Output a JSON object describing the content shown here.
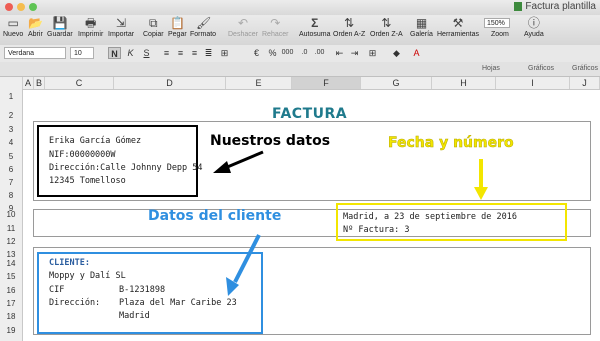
{
  "window": {
    "title": "Factura plantilla"
  },
  "toolbar": {
    "buttons": [
      {
        "label": "Nuevo",
        "icon": "new-file-icon"
      },
      {
        "label": "Abrir",
        "icon": "open-folder-icon"
      },
      {
        "label": "Guardar",
        "icon": "save-icon"
      },
      {
        "label": "Imprimir",
        "icon": "print-icon"
      },
      {
        "label": "Importar",
        "icon": "import-icon"
      },
      {
        "label": "Copiar",
        "icon": "copy-icon"
      },
      {
        "label": "Pegar",
        "icon": "paste-icon"
      },
      {
        "label": "Formato",
        "icon": "format-brush-icon"
      },
      {
        "label": "Deshacer",
        "icon": "undo-icon"
      },
      {
        "label": "Rehacer",
        "icon": "redo-icon"
      },
      {
        "label": "Autosuma",
        "icon": "autosum-icon"
      },
      {
        "label": "Orden A-Z",
        "icon": "sort-asc-icon"
      },
      {
        "label": "Orden Z-A",
        "icon": "sort-desc-icon"
      },
      {
        "label": "Galería",
        "icon": "gallery-icon"
      },
      {
        "label": "Herramientas",
        "icon": "tools-icon"
      },
      {
        "label": "Zoom",
        "icon": "zoom-icon"
      },
      {
        "label": "Ayuda",
        "icon": "help-icon"
      }
    ],
    "zoom_value": "150%"
  },
  "format": {
    "font": "Verdana",
    "size": "10"
  },
  "ribbon": {
    "tabs": [
      "Hojas",
      "Gráficos",
      "Gráficos"
    ]
  },
  "columns": [
    "A",
    "B",
    "C",
    "D",
    "E",
    "F",
    "G",
    "H",
    "I",
    "J"
  ],
  "rows": [
    "1",
    "2",
    "3",
    "4",
    "5",
    "6",
    "7",
    "8",
    "9",
    "10",
    "11",
    "12",
    "13",
    "14",
    "15",
    "16",
    "17",
    "18",
    "19"
  ],
  "invoice": {
    "title": "FACTURA",
    "issuer": {
      "name": "Erika García Gómez",
      "nif": "NIF:00000000W",
      "address": "Dirección:Calle Johnny Depp 54",
      "city": "12345 Tomelloso"
    },
    "date_line": "Madrid, a 23 de septiembre de 2016",
    "invoice_number": "Nº Factura: 3",
    "client": {
      "header": "CLIENTE:",
      "name": "Moppy y Dalí SL",
      "cif_label": "CIF",
      "cif_value": "B-1231898",
      "address_label": "Dirección:",
      "address_value": "Plaza del Mar Caribe 23",
      "city": "Madrid"
    }
  },
  "annotations": {
    "our_data": "Nuestros datos",
    "date_number": "Fecha y número",
    "client_data": "Datos del cliente"
  },
  "colors": {
    "black_box": "#000000",
    "yellow": "#f3e600",
    "blue": "#2f8fe0",
    "teal_title": "#1f7a8c"
  }
}
